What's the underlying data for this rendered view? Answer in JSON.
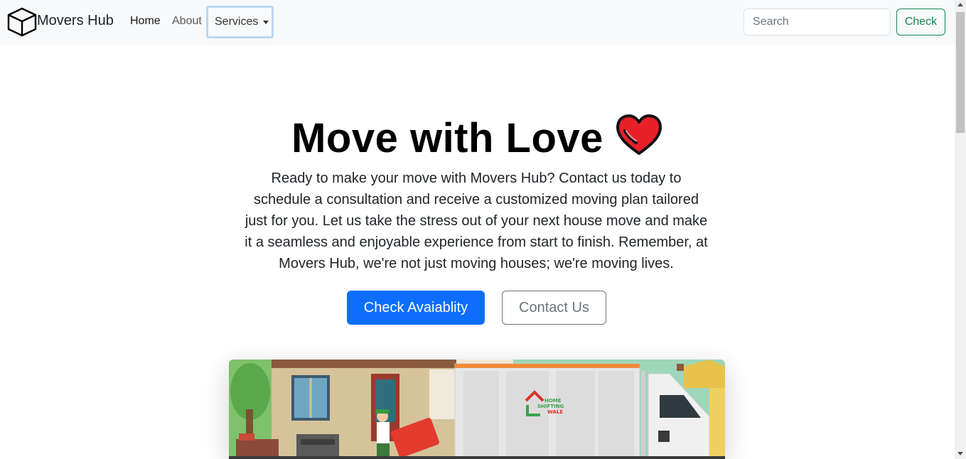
{
  "navbar": {
    "brand": {
      "icon": "box-icon",
      "text": "Movers Hub"
    },
    "links": [
      {
        "label": "Home"
      },
      {
        "label": "About"
      },
      {
        "label": "Services",
        "icon": "caret-down-icon"
      }
    ],
    "search": {
      "placeholder": "Search",
      "value": ""
    },
    "check_button": "Check"
  },
  "hero": {
    "title": "Move with Love",
    "title_icon": "heart-icon",
    "text": "Ready to make your move with Movers Hub? Contact us today to schedule a consultation and receive a customized moving plan tailored just for you. Let us take the stress out of your next house move and make it a seamless and enjoyable experience from start to finish. Remember, at Movers Hub, we're not just moving houses; we're moving lives.",
    "primary_button": "Check Avaiablity",
    "secondary_button": "Contact Us",
    "image": {
      "truck_logo_line1": "HOME",
      "truck_logo_line2": "SHIFTING",
      "truck_logo_line3": "WALE"
    }
  },
  "colors": {
    "primary": "#0d6efd",
    "success": "#198754",
    "secondary": "#6c757d",
    "navbar_bg": "#f8f9fa"
  }
}
